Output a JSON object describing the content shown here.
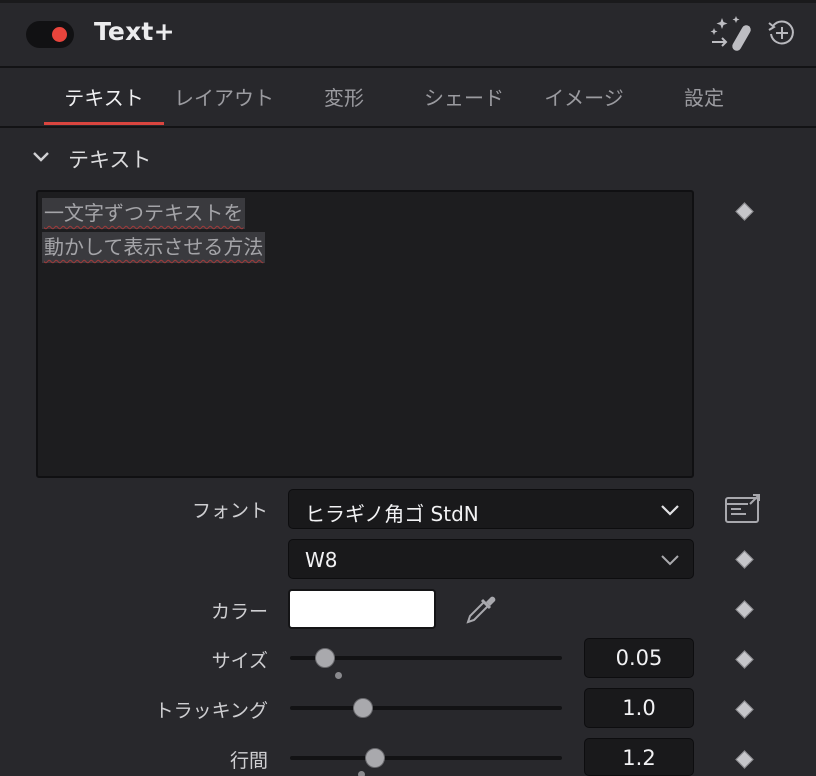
{
  "header": {
    "title": "Text+",
    "toggle_state": "on",
    "toggle_color": "#e9443c",
    "magic_icon": "magic-wand-icon",
    "reset_icon": "reset-icon"
  },
  "tabs": [
    {
      "label": "テキスト",
      "active": true
    },
    {
      "label": "レイアウト",
      "active": false
    },
    {
      "label": "変形",
      "active": false
    },
    {
      "label": "シェード",
      "active": false
    },
    {
      "label": "イメージ",
      "active": false
    },
    {
      "label": "設定",
      "active": false
    }
  ],
  "accent_color": "#d9453f",
  "section": {
    "title": "テキスト",
    "text_lines": [
      "一文字ずつテキストを",
      "動かして表示させる方法"
    ]
  },
  "font": {
    "label": "フォント",
    "family": "ヒラギノ角ゴ StdN",
    "style": "W8"
  },
  "color": {
    "label": "カラー",
    "value": "#ffffff"
  },
  "size": {
    "label": "サイズ",
    "value": "0.05"
  },
  "tracking": {
    "label": "トラッキング",
    "value": "1.0"
  },
  "line_spacing": {
    "label": "行間",
    "value": "1.2"
  }
}
